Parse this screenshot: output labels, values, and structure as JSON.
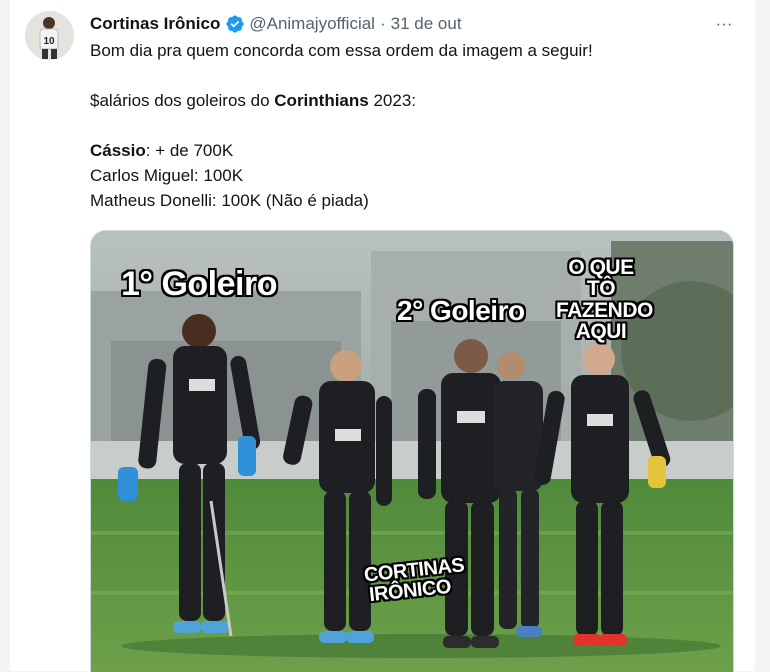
{
  "tweet": {
    "display_name": "Cortinas Irônico",
    "handle": "@Animajyofficial",
    "separator": "·",
    "date": "31 de out",
    "more_label": "···",
    "lines": {
      "line1": "Bom dia pra quem concorda com essa ordem da imagem a seguir!",
      "line2_prefix": "$alários dos goleiros do ",
      "line2_bold": "Corinthians",
      "line2_suffix": " 2023:",
      "line3_bold": "Cássio",
      "line3_rest": ": + de 700K",
      "line4": "Carlos Miguel: 100K",
      "line5": "Matheus Donelli: 100K (Não é piada)"
    },
    "verified_color": "#1d9bf0"
  },
  "media": {
    "label_goleiro1": "1° Goleiro",
    "label_goleiro2": "2° Goleiro",
    "label_third": "O QUE TÔ FAZENDO AQUI",
    "label_cortinas": "CORTINAS IRÔNICO"
  }
}
